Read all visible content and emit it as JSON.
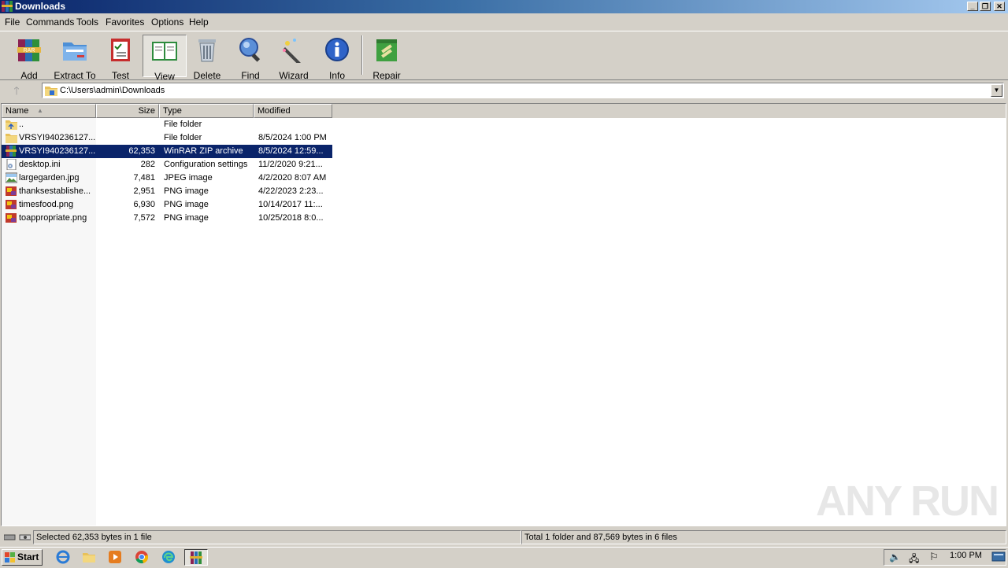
{
  "window": {
    "title": "Downloads"
  },
  "menu": [
    "File",
    "Commands",
    "Tools",
    "Favorites",
    "Options",
    "Help"
  ],
  "toolbar": {
    "add": "Add",
    "extract_to": "Extract To",
    "test": "Test",
    "view": "View",
    "delete": "Delete",
    "find": "Find",
    "wizard": "Wizard",
    "info": "Info",
    "repair": "Repair"
  },
  "address": {
    "path": "C:\\Users\\admin\\Downloads"
  },
  "columns": {
    "name": "Name",
    "size": "Size",
    "type": "Type",
    "modified": "Modified"
  },
  "files": [
    {
      "name": "..",
      "size": "",
      "type": "File folder",
      "modified": "",
      "icon": "parent-folder-icon"
    },
    {
      "name": "VRSYI940236127...",
      "size": "",
      "type": "File folder",
      "modified": "8/5/2024 1:00 PM",
      "icon": "folder-icon"
    },
    {
      "name": "VRSYI940236127...",
      "size": "62,353",
      "type": "WinRAR ZIP archive",
      "modified": "8/5/2024 12:59...",
      "icon": "zip-archive-icon",
      "selected": true
    },
    {
      "name": "desktop.ini",
      "size": "282",
      "type": "Configuration settings",
      "modified": "11/2/2020 9:21...",
      "icon": "config-file-icon"
    },
    {
      "name": "largegarden.jpg",
      "size": "7,481",
      "type": "JPEG image",
      "modified": "4/2/2020 8:07 AM",
      "icon": "jpeg-image-icon"
    },
    {
      "name": "thanksestablishe...",
      "size": "2,951",
      "type": "PNG image",
      "modified": "4/22/2023 2:23...",
      "icon": "png-image-icon"
    },
    {
      "name": "timesfood.png",
      "size": "6,930",
      "type": "PNG image",
      "modified": "10/14/2017 11:...",
      "icon": "png-image-icon"
    },
    {
      "name": "toappropriate.png",
      "size": "7,572",
      "type": "PNG image",
      "modified": "10/25/2018 8:0...",
      "icon": "png-image-icon"
    }
  ],
  "status": {
    "selected": "Selected 62,353 bytes in 1 file",
    "total": "Total 1 folder and 87,569 bytes in 6 files"
  },
  "taskbar": {
    "start": "Start",
    "clock": "1:00 PM"
  },
  "watermark": "ANY RUN",
  "colors": {
    "title_start": "#0a246a",
    "selection": "#0a246a",
    "face": "#d4d0c8"
  }
}
